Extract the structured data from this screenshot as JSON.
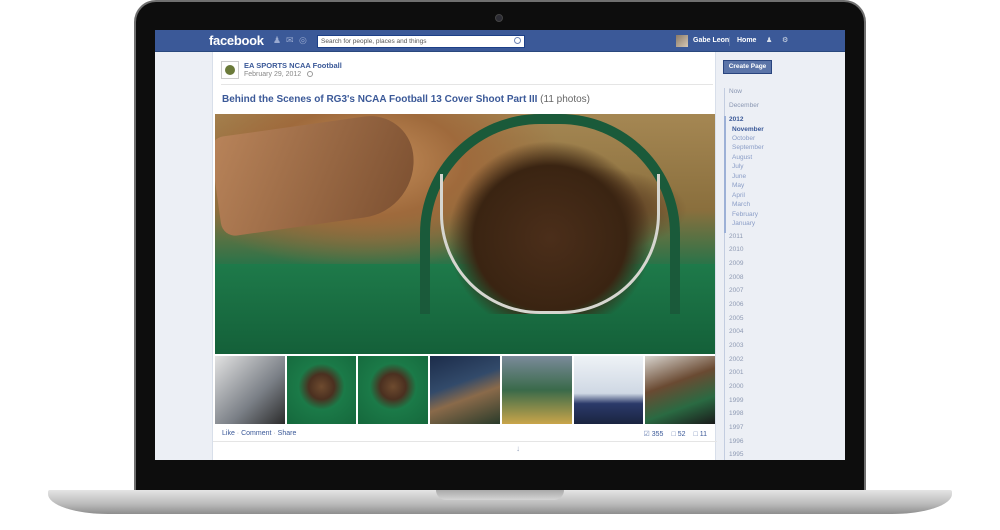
{
  "topbar": {
    "logo": "facebook",
    "search_placeholder": "Search for people, places and things",
    "user_name": "Gabe Leon",
    "home": "Home"
  },
  "post": {
    "page_name": "EA SPORTS NCAA Football",
    "date": "February 29, 2012",
    "album_title": "Behind the Scenes of RG3's NCAA Football 13 Cover Shoot Part III",
    "album_count": "(11 photos)",
    "actions": {
      "like": "Like",
      "comment": "Comment",
      "share": "Share",
      "sep": " · "
    },
    "stats": {
      "likes": "355",
      "comments": "52",
      "shares": "11"
    }
  },
  "sidebar": {
    "create_page": "Create Page",
    "timeline": {
      "now": "Now",
      "december": "December",
      "current_year": "2012",
      "months": [
        "November",
        "October",
        "September",
        "August",
        "July",
        "June",
        "May",
        "April",
        "March",
        "February",
        "January"
      ],
      "years": [
        "2011",
        "2010",
        "2009",
        "2008",
        "2007",
        "2006",
        "2005",
        "2004",
        "2003",
        "2002",
        "2001",
        "2000",
        "1999",
        "1998",
        "1997",
        "1996",
        "1995"
      ]
    }
  },
  "colors": {
    "brand": "#3b5998",
    "jersey_green": "#1e7a4a"
  }
}
